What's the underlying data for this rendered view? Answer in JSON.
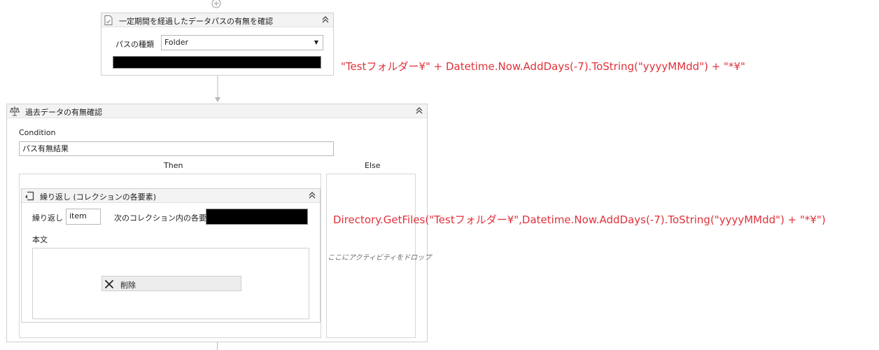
{
  "top_add_icon": "plus-circle-icon",
  "assign_activity": {
    "title": "一定期間を経過したデータパスの有無を確認",
    "icon": "file-check-icon",
    "path_type_label": "パスの種類",
    "path_type_value": "Folder",
    "path_value": ""
  },
  "annotation_path": "\"Testフォルダー¥\" + Datetime.Now.AddDays(-7).ToString(\"yyyyMMdd\") + \"*¥\"",
  "if_activity": {
    "title": "過去データの有無確認",
    "icon": "scale-icon",
    "condition_label": "Condition",
    "condition_value": "パス有無結果",
    "then_label": "Then",
    "else_label": "Else",
    "else_placeholder": "ここにアクティビティをドロップ"
  },
  "foreach_activity": {
    "title": "繰り返し (コレクションの各要素)",
    "icon": "loop-icon",
    "repeat_label": "繰り返し",
    "item_value": "item",
    "collection_label": "次のコレクション内の各要素:",
    "collection_value": "",
    "body_label": "本文",
    "delete_label": "削除"
  },
  "annotation_files": "Directory.GetFiles(\"Testフォルダー¥\",Datetime.Now.AddDays(-7).ToString(\"yyyyMMdd\") + \"*¥\")",
  "colors": {
    "annotation": "#e0323a",
    "connector": "#b8b8b8",
    "header": "#f3f3f3"
  }
}
